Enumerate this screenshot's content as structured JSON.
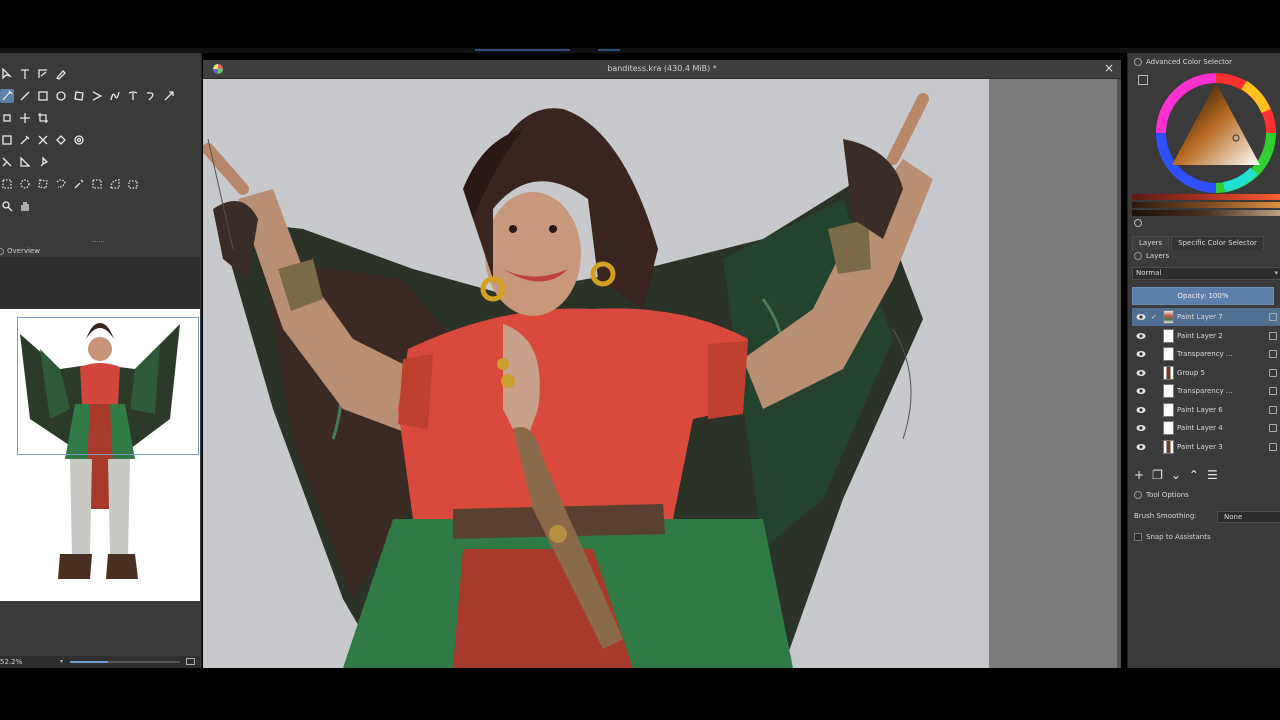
{
  "document": {
    "title": "banditess.kra (430.4 MiB) *",
    "close_symbol": "×"
  },
  "left_panel": {
    "overview_title": "Overview",
    "zoom": "52.2%"
  },
  "right_panel": {
    "color_selector_title": "Advanced Color Selector",
    "tabs": [
      "Layers",
      "Specific Color Selector"
    ],
    "layers_title": "Layers",
    "blend_mode": "Normal",
    "opacity": "Opacity:  100%",
    "layers": [
      {
        "name": "Paint Layer 7",
        "selected": true,
        "checked": true,
        "thumb": "fig"
      },
      {
        "name": "Paint Layer 2",
        "selected": false,
        "checked": false,
        "thumb": "plain"
      },
      {
        "name": "Transparency ...",
        "selected": false,
        "checked": false,
        "thumb": "plain"
      },
      {
        "name": "Group 5",
        "selected": false,
        "checked": false,
        "thumb": "grp"
      },
      {
        "name": "Transparency ...",
        "selected": false,
        "checked": false,
        "thumb": "plain"
      },
      {
        "name": "Paint Layer 6",
        "selected": false,
        "checked": false,
        "thumb": "plain"
      },
      {
        "name": "Paint Layer 4",
        "selected": false,
        "checked": false,
        "thumb": "plain"
      },
      {
        "name": "Paint Layer 3",
        "selected": false,
        "checked": false,
        "thumb": "grp"
      }
    ],
    "tool_options_title": "Tool Options",
    "brush_smoothing_label": "Brush Smoothing:",
    "brush_smoothing_value": "None",
    "snap_label": "Snap to Assistants"
  },
  "colors": {
    "accent": "#5b7fa8",
    "panel_bg": "#3a3a3a",
    "canvas_bg": "#c8c9cc"
  }
}
